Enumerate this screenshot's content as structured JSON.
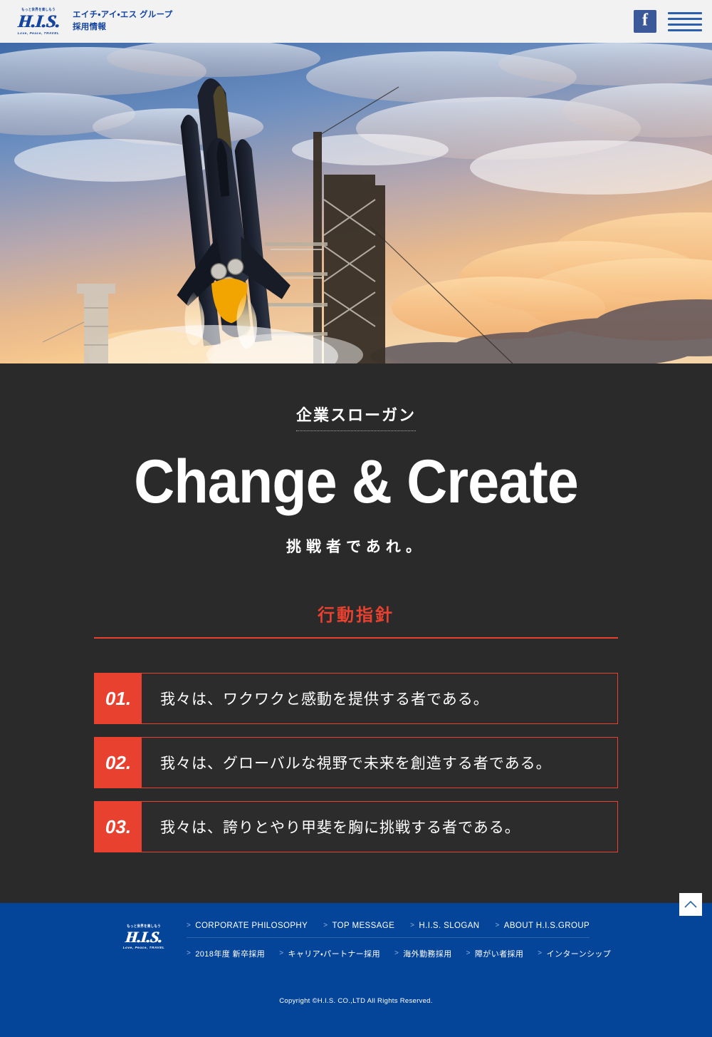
{
  "header": {
    "logo": {
      "tagline": "もっと世界を楽しもう",
      "mark": "H.I.S.",
      "subline": "Love, Peace, TRAVEL"
    },
    "brand_line1": "エイチ・アイ・エス グループ",
    "brand_line2": "採用情報",
    "facebook_icon": "facebook-icon",
    "menu_icon": "hamburger-menu-icon"
  },
  "hero": {
    "alt": "space-shuttle-launch-at-sunset"
  },
  "slogan": {
    "label": "企業スローガン",
    "title": "Change & Create",
    "subtitle": "挑戦者であれ。"
  },
  "policy": {
    "heading": "行動指針",
    "items": [
      {
        "number": "01.",
        "text": "我々は、ワクワクと感動を提供する者である。"
      },
      {
        "number": "02.",
        "text": "我々は、グローバルな視野で未来を創造する者である。"
      },
      {
        "number": "03.",
        "text": "我々は、誇りとやり甲斐を胸に挑戦する者である。"
      }
    ]
  },
  "scroll_top": {
    "icon": "chevron-up-icon"
  },
  "footer": {
    "logo": {
      "tagline": "もっと世界を楽しもう",
      "mark": "H.I.S.",
      "subline": "Love, Peace, TRAVEL"
    },
    "nav_row1": [
      "CORPORATE PHILOSOPHY",
      "TOP MESSAGE",
      "H.I.S. SLOGAN",
      "ABOUT H.I.S.GROUP"
    ],
    "nav_row2": [
      "2018年度 新卒採用",
      "キャリア・パートナー採用",
      "海外勤務採用",
      "障がい者採用",
      "インターンシップ"
    ],
    "copyright": "Copyright ©H.I.S. CO.,LTD All Rights Reserved."
  },
  "colors": {
    "brand_blue": "#14449e",
    "footer_blue": "#04459a",
    "accent_red": "#e8412f",
    "dark_bg": "#2a2a2a",
    "header_bg": "#f2f2f2",
    "facebook_blue": "#3b5998"
  }
}
